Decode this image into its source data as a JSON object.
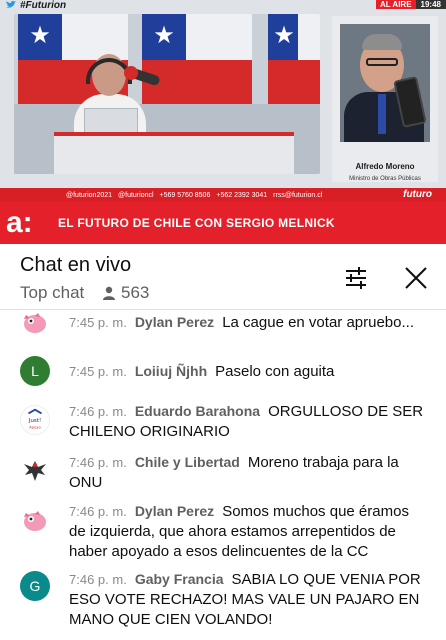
{
  "video": {
    "hashtag": "#Futurion",
    "live_label": "AL AIRE",
    "clock": "19:48",
    "social": [
      "@futurion2021",
      "@futurioncl",
      "+569 5760 8506",
      "+562 2392 3041",
      "rrss@futurion.cl"
    ],
    "brand": "futuro",
    "show_logo": "a:",
    "show_title": "EL FUTURO DE CHILE CON SERGIO MELNICK",
    "guest_name": "Alfredo Moreno",
    "guest_role": "Ministro de Obras Públicas"
  },
  "chat": {
    "title": "Chat en vivo",
    "mode": "Top chat",
    "viewers": "563"
  },
  "messages": [
    {
      "time": "7:45 p. m.",
      "author": "Dylan Perez",
      "text": "La cague en votar apruebo...",
      "avatar_color": "#f6c6d6",
      "avatar_letter": "",
      "avatar_icon": "pink-creature-icon"
    },
    {
      "time": "7:45 p. m.",
      "author": "Loiiuj Ñjhh",
      "text": "Paselo con aguita",
      "avatar_color": "#2e7d32",
      "avatar_letter": "L",
      "avatar_icon": ""
    },
    {
      "time": "7:46 p. m.",
      "author": "Eduardo Barahona",
      "text": "ORGULLOSO DE SER CHILENO ORIGINARIO",
      "avatar_color": "#f4f4f4",
      "avatar_letter": "",
      "avatar_icon": "logo-icon"
    },
    {
      "time": "7:46 p. m.",
      "author": "Chile y Libertad",
      "text": "Moreno trabaja para la ONU",
      "avatar_color": "#f4f4f4",
      "avatar_letter": "",
      "avatar_icon": "eagle-icon"
    },
    {
      "time": "7:46 p. m.",
      "author": "Dylan Perez",
      "text": "Somos muchos que éramos de izquierda, que ahora estamos arrepentidos de haber apoyado a esos delincuentes de la CC",
      "avatar_color": "#f6c6d6",
      "avatar_letter": "",
      "avatar_icon": "pink-creature-icon"
    },
    {
      "time": "7:46 p. m.",
      "author": "Gaby Francia",
      "text": "SABIA LO QUE VENIA POR ESO VOTE RECHAZO! MAS VALE UN PAJARO EN MANO QUE CIEN VOLANDO!",
      "avatar_color": "#0a8a8a",
      "avatar_letter": "G",
      "avatar_icon": ""
    }
  ]
}
